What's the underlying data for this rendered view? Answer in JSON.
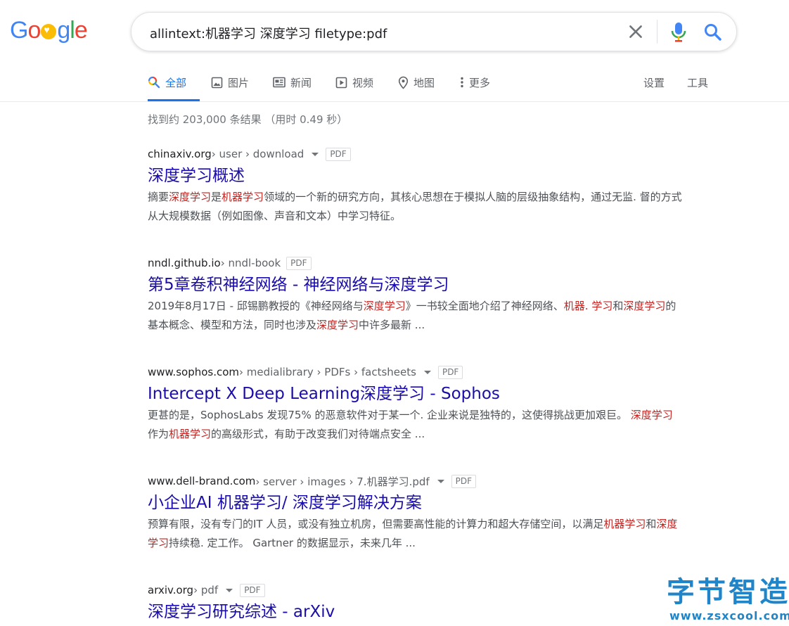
{
  "logo": {
    "letters": [
      "G",
      "o",
      "",
      "g",
      "l",
      "e"
    ],
    "colors": [
      "#4285f4",
      "#ea4335",
      "#fbbc05",
      "#4285f4",
      "#34a853",
      "#ea4335"
    ]
  },
  "search": {
    "query": "allintext:机器学习 深度学习 filetype:pdf"
  },
  "tabs": {
    "all": "全部",
    "images": "图片",
    "news": "新闻",
    "videos": "视频",
    "maps": "地图",
    "more": "更多",
    "settings": "设置",
    "tools": "工具"
  },
  "stats": "找到约 203,000 条结果 （用时 0.49 秒）",
  "results": [
    {
      "domain": "chinaxiv.org",
      "path": " › user › download",
      "badge": "PDF",
      "title": "深度学习概述",
      "snippet": [
        {
          "t": "摘要",
          "h": false
        },
        {
          "t": "深度学习",
          "h": true
        },
        {
          "t": "是",
          "h": false
        },
        {
          "t": "机器学习",
          "h": true
        },
        {
          "t": "领域的一个新的研究方向，其核心思想在于模拟人脑的层级抽象结构，通过无监. 督的方式从大规模数据（例如图像、声音和文本）中学习特征。",
          "h": false
        }
      ]
    },
    {
      "domain": "nndl.github.io",
      "path": " › nndl-book",
      "badge": "PDF",
      "title": "第5章卷积神经网络 - 神经网络与深度学习",
      "snippet": [
        {
          "t": "2019年8月17日 - 邱锡鹏教授的《神经网络与",
          "h": false
        },
        {
          "t": "深度学习",
          "h": true
        },
        {
          "t": "》一书较全面地介绍了神经网络、",
          "h": false
        },
        {
          "t": "机器. 学习",
          "h": true
        },
        {
          "t": "和",
          "h": false
        },
        {
          "t": "深度学习",
          "h": true
        },
        {
          "t": "的基本概念、模型和方法，同时也涉及",
          "h": false
        },
        {
          "t": "深度学习",
          "h": true
        },
        {
          "t": "中许多最新 ...",
          "h": false
        }
      ]
    },
    {
      "domain": "www.sophos.com",
      "path": " › medialibrary › PDFs › factsheets",
      "badge": "PDF",
      "title": "Intercept X Deep Learning深度学习 - Sophos",
      "snippet": [
        {
          "t": "更甚的是，SophosLabs 发现75% 的恶意软件对于某一个. 企业来说是独特的，这使得挑战更加艰巨。 ",
          "h": false
        },
        {
          "t": "深度学习",
          "h": true
        },
        {
          "t": "作为",
          "h": false
        },
        {
          "t": "机器学习",
          "h": true
        },
        {
          "t": "的高级形式，有助于改变我们对待端点安全 ...",
          "h": false
        }
      ]
    },
    {
      "domain": "www.dell-brand.com",
      "path": " › server › images › 7.机器学习.pdf",
      "badge": "PDF",
      "title": "小企业AI 机器学习/ 深度学习解决方案",
      "snippet": [
        {
          "t": "预算有限，没有专门的IT 人员，或没有独立机房，但需要高性能的计算力和超大存储空间，以满足",
          "h": false
        },
        {
          "t": "机器学习",
          "h": true
        },
        {
          "t": "和",
          "h": false
        },
        {
          "t": "深度学习",
          "h": true
        },
        {
          "t": "持续稳. 定工作。 Gartner 的数据显示，未来几年 ...",
          "h": false
        }
      ]
    },
    {
      "domain": "arxiv.org",
      "path": " › pdf",
      "badge": "PDF",
      "title": "深度学习研究综述 - arXiv",
      "snippet": []
    }
  ],
  "watermark": {
    "text": "字节智造",
    "url": "www.zsxcool.com"
  }
}
